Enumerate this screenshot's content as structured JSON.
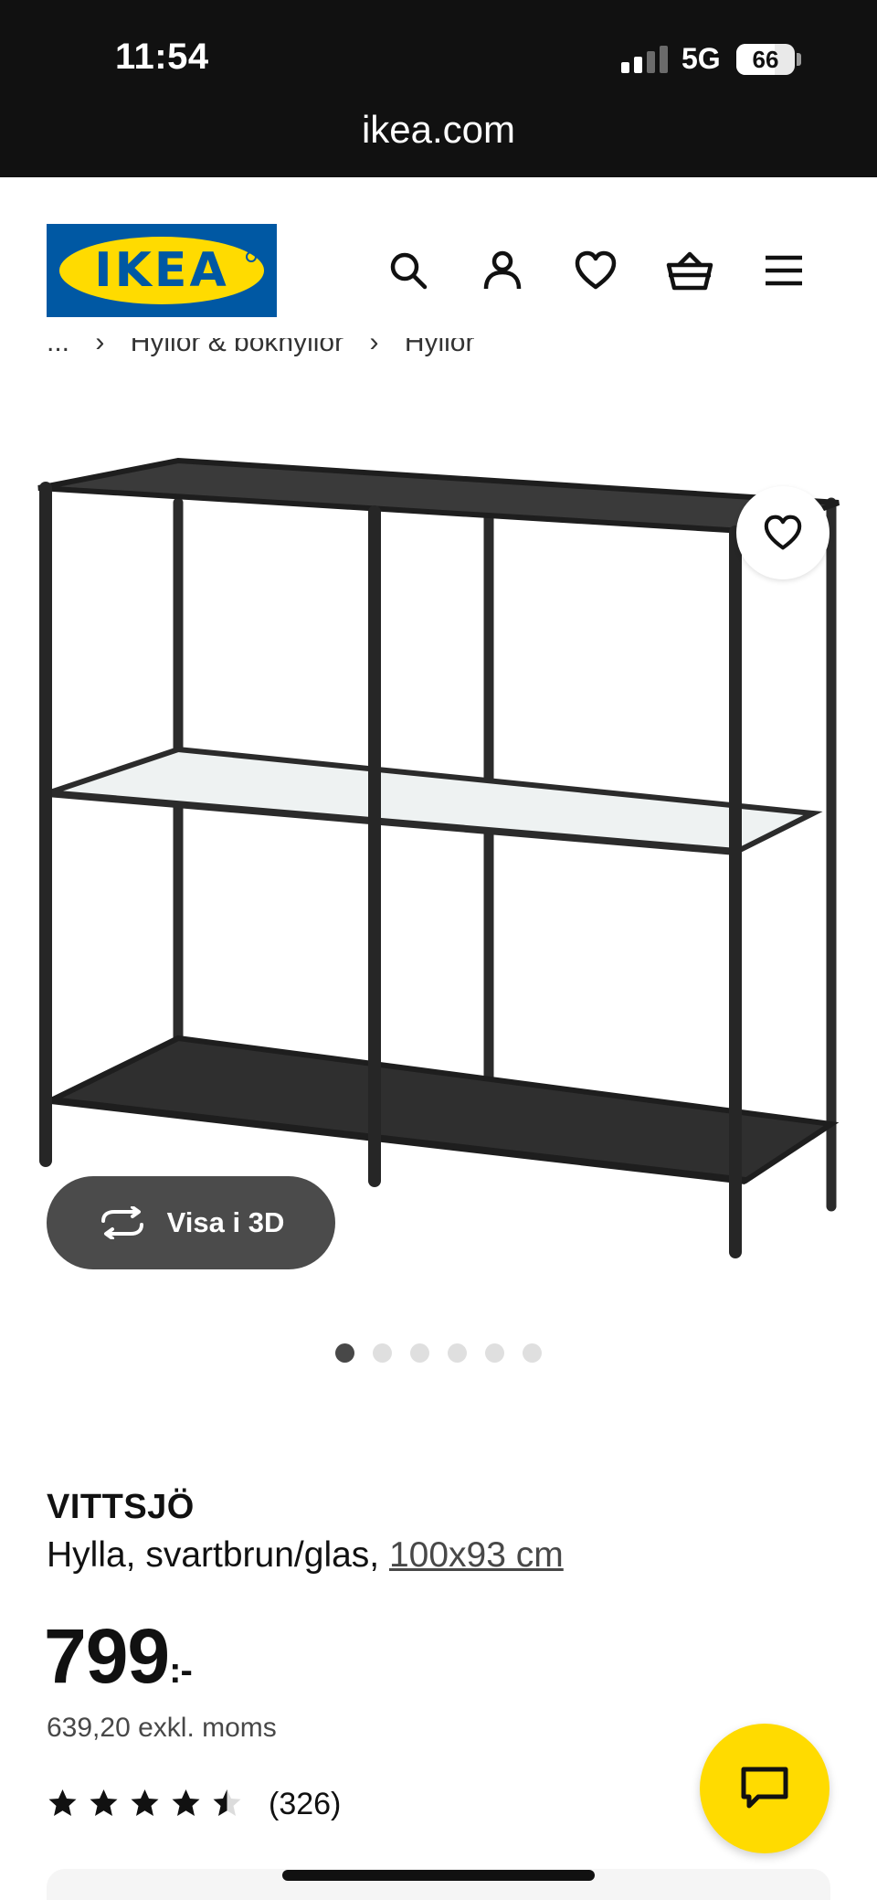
{
  "status_bar": {
    "time": "11:54",
    "network": "5G",
    "battery_level": "66",
    "battery_fraction": 0.66,
    "signal_bars_active": 2,
    "signal_bars_total": 4
  },
  "browser": {
    "url": "ikea.com"
  },
  "header": {
    "logo_text": "IKEA",
    "icons": [
      "search-icon",
      "account-icon",
      "wishlist-icon",
      "cart-icon",
      "menu-icon"
    ]
  },
  "breadcrumb": [
    "...",
    "Hyllor & bokhyllor",
    "Hyllor"
  ],
  "gallery": {
    "view_3d_label": "Visa i 3D",
    "image_count": 6,
    "active_index": 0
  },
  "product": {
    "name": "VITTSJÖ",
    "description": "Hylla, svartbrun/glas, ",
    "size": "100x93 cm",
    "price": "799",
    "price_suffix": ":-",
    "price_ex_vat": "639,20 exkl. moms",
    "rating": 4.5,
    "review_count": "(326)"
  },
  "colors": {
    "ikea_blue": "#0058a3",
    "ikea_yellow": "#ffdb00",
    "frame": "#2b2b2b"
  }
}
